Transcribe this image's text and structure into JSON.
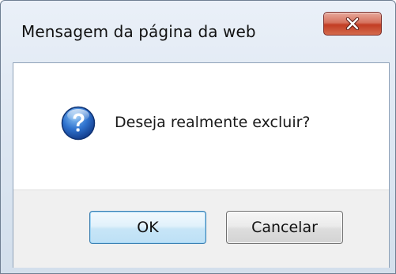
{
  "dialog": {
    "title": "Mensagem da página da web",
    "close_icon": "close-icon",
    "message_icon": "question-icon",
    "message": "Deseja realmente excluir?",
    "ok_label": "OK",
    "cancel_label": "Cancelar"
  },
  "colors": {
    "close_button": "#c7432b",
    "ok_button_border": "#3c7fb1",
    "question_icon": "#1f5fb8"
  }
}
